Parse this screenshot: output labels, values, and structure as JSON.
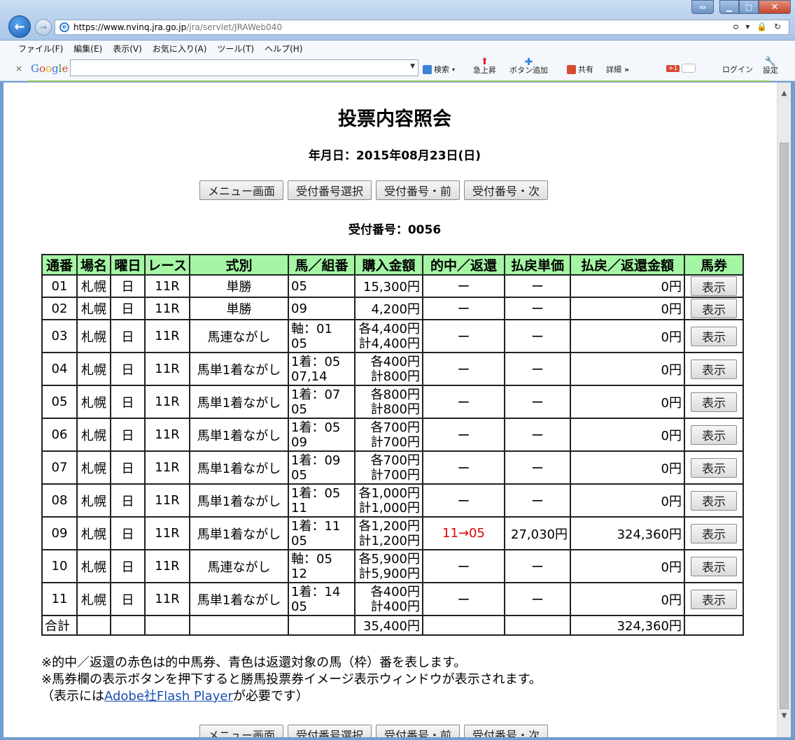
{
  "browser": {
    "url_host": "https://www.nvinq.jra.go.jp",
    "url_path": "/jra/servlet/JRAWeb040",
    "addr_tools": "ᴑ ▾ 🔒 ↻",
    "menu": [
      "ファイル(F)",
      "編集(E)",
      "表示(V)",
      "お気に入り(A)",
      "ツール(T)",
      "ヘルプ(H)"
    ],
    "google_toolbar": {
      "search_label": "検索",
      "rising_label": "急上昇",
      "add_button_label": "ボタン追加",
      "share_label": "共有",
      "detail_label": "詳細",
      "more_glyph": "»",
      "gplus_label": "+1",
      "login_label": "ログイン",
      "settings_label": "設定"
    }
  },
  "page": {
    "title": "投票内容照会",
    "date_line": "年月日：2015年08月23日(日)",
    "buttons": [
      "メニュー画面",
      "受付番号選択",
      "受付番号・前",
      "受付番号・次"
    ],
    "receipt_line": "受付番号：0056",
    "table": {
      "headers": [
        "通番",
        "場名",
        "曜日",
        "レース",
        "式別",
        "馬／組番",
        "購入金額",
        "的中／返還",
        "払戻単価",
        "払戻／返還金額",
        "馬券"
      ],
      "show_label": "表示",
      "rows": [
        {
          "no": "01",
          "venue": "札幌",
          "day": "日",
          "race": "11R",
          "type": "単勝",
          "horse1": "05",
          "horse2": "",
          "amt1": "15,300円",
          "amt2": "",
          "hit": "ー",
          "unit": "ー",
          "payout": "0円"
        },
        {
          "no": "02",
          "venue": "札幌",
          "day": "日",
          "race": "11R",
          "type": "単勝",
          "horse1": "09",
          "horse2": "",
          "amt1": "4,200円",
          "amt2": "",
          "hit": "ー",
          "unit": "ー",
          "payout": "0円"
        },
        {
          "no": "03",
          "venue": "札幌",
          "day": "日",
          "race": "11R",
          "type": "馬連ながし",
          "horse1": "軸：01",
          "horse2": "05",
          "amt1": "各4,400円",
          "amt2": "計4,400円",
          "hit": "ー",
          "unit": "ー",
          "payout": "0円"
        },
        {
          "no": "04",
          "venue": "札幌",
          "day": "日",
          "race": "11R",
          "type": "馬単1着ながし",
          "horse1": "1着：05",
          "horse2": "07,14",
          "amt1": "各400円",
          "amt2": "計800円",
          "hit": "ー",
          "unit": "ー",
          "payout": "0円"
        },
        {
          "no": "05",
          "venue": "札幌",
          "day": "日",
          "race": "11R",
          "type": "馬単1着ながし",
          "horse1": "1着：07",
          "horse2": "05",
          "amt1": "各800円",
          "amt2": "計800円",
          "hit": "ー",
          "unit": "ー",
          "payout": "0円"
        },
        {
          "no": "06",
          "venue": "札幌",
          "day": "日",
          "race": "11R",
          "type": "馬単1着ながし",
          "horse1": "1着：05",
          "horse2": "09",
          "amt1": "各700円",
          "amt2": "計700円",
          "hit": "ー",
          "unit": "ー",
          "payout": "0円"
        },
        {
          "no": "07",
          "venue": "札幌",
          "day": "日",
          "race": "11R",
          "type": "馬単1着ながし",
          "horse1": "1着：09",
          "horse2": "05",
          "amt1": "各700円",
          "amt2": "計700円",
          "hit": "ー",
          "unit": "ー",
          "payout": "0円"
        },
        {
          "no": "08",
          "venue": "札幌",
          "day": "日",
          "race": "11R",
          "type": "馬単1着ながし",
          "horse1": "1着：05",
          "horse2": "11",
          "amt1": "各1,000円",
          "amt2": "計1,000円",
          "hit": "ー",
          "unit": "ー",
          "payout": "0円"
        },
        {
          "no": "09",
          "venue": "札幌",
          "day": "日",
          "race": "11R",
          "type": "馬単1着ながし",
          "horse1": "1着：11",
          "horse2": "05",
          "amt1": "各1,200円",
          "amt2": "計1,200円",
          "hit": "11→05",
          "unit": "27,030円",
          "payout": "324,360円"
        },
        {
          "no": "10",
          "venue": "札幌",
          "day": "日",
          "race": "11R",
          "type": "馬連ながし",
          "horse1": "軸：05",
          "horse2": "12",
          "amt1": "各5,900円",
          "amt2": "計5,900円",
          "hit": "ー",
          "unit": "ー",
          "payout": "0円"
        },
        {
          "no": "11",
          "venue": "札幌",
          "day": "日",
          "race": "11R",
          "type": "馬単1着ながし",
          "horse1": "1着：14",
          "horse2": "05",
          "amt1": "各400円",
          "amt2": "計400円",
          "hit": "ー",
          "unit": "ー",
          "payout": "0円"
        }
      ],
      "total": {
        "label": "合計",
        "amount": "35,400円",
        "payout": "324,360円"
      }
    },
    "notes": {
      "line1": "※的中／返還の赤色は的中馬券、青色は返還対象の馬（枠）番を表します。",
      "line2": "※馬券欄の表示ボタンを押下すると勝馬投票券イメージ表示ウィンドウが表示されます。",
      "line3_prefix": "（表示には",
      "line3_link": "Adobe社Flash Player",
      "line3_suffix": "が必要です）"
    }
  },
  "colors": {
    "header_bg": "#a4f5a4",
    "hit_red": "#e00000",
    "link_blue": "#1a4fb0"
  }
}
